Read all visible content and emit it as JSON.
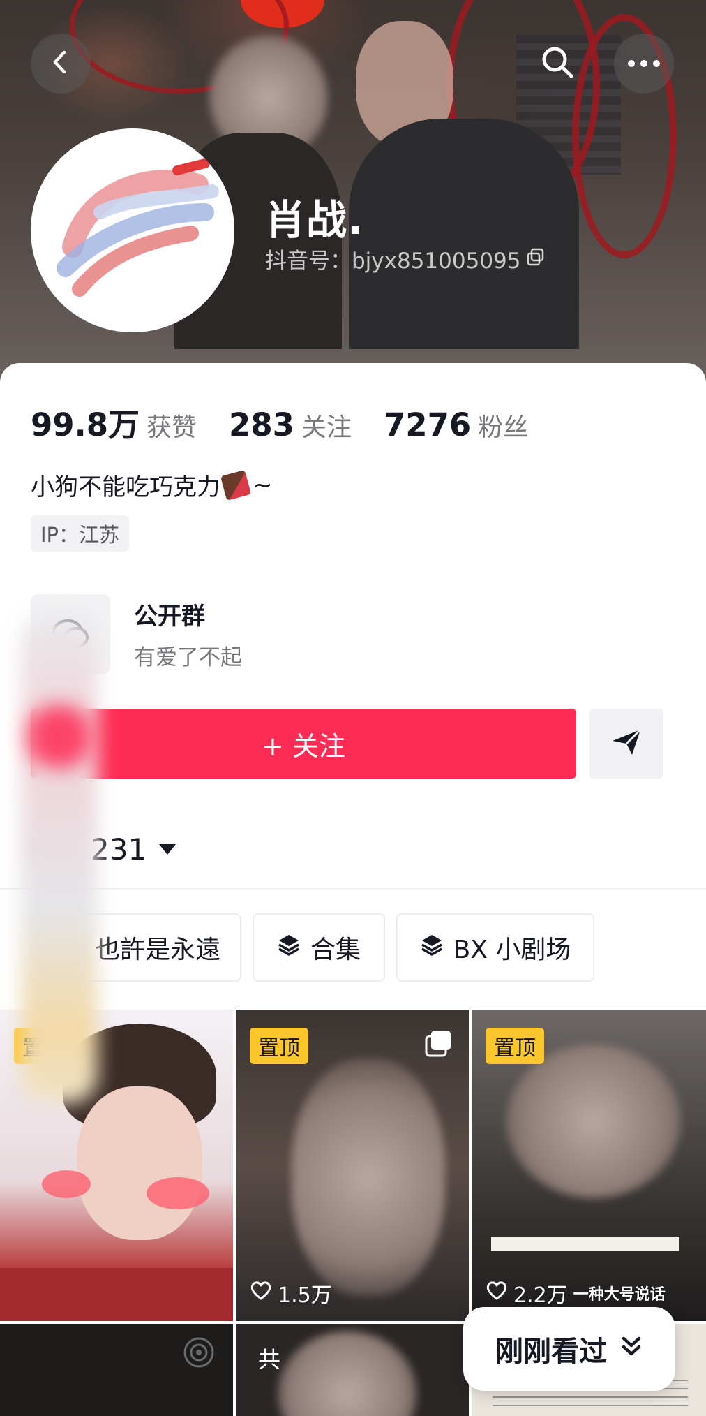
{
  "header": {
    "name": "肖战.",
    "douyin_id": "抖音号：bjyx851005095",
    "back_icon": "chevron-left-icon",
    "search_icon": "search-icon",
    "more_icon": "more-dots-icon"
  },
  "stats": [
    {
      "value": "99.8万",
      "label": "获赞"
    },
    {
      "value": "283",
      "label": "关注"
    },
    {
      "value": "7276",
      "label": "粉丝"
    }
  ],
  "bio": "小狗不能吃巧克力",
  "bio_suffix": "~",
  "ip_location": "IP：江苏",
  "group": {
    "title": "公开群",
    "subtitle": "有爱了不起"
  },
  "follow_button": "+ 关注",
  "works_tab": {
    "count": "231"
  },
  "chips": [
    {
      "label": "也許是永遠",
      "icon": ""
    },
    {
      "label": "合集",
      "icon": "layers-icon"
    },
    {
      "label": "BX 小剧场",
      "icon": "layers-icon"
    }
  ],
  "videos": [
    {
      "pinned": "置顶",
      "likes": ""
    },
    {
      "pinned": "置顶",
      "likes": "1.5万"
    },
    {
      "pinned": "置顶",
      "likes": "2.2万",
      "overlay": "一种大号说话"
    },
    {
      "badge": "共"
    }
  ],
  "recent_pill": "刚刚看过",
  "colors": {
    "follow": "#fe2c55",
    "pin": "#fcc62d"
  }
}
